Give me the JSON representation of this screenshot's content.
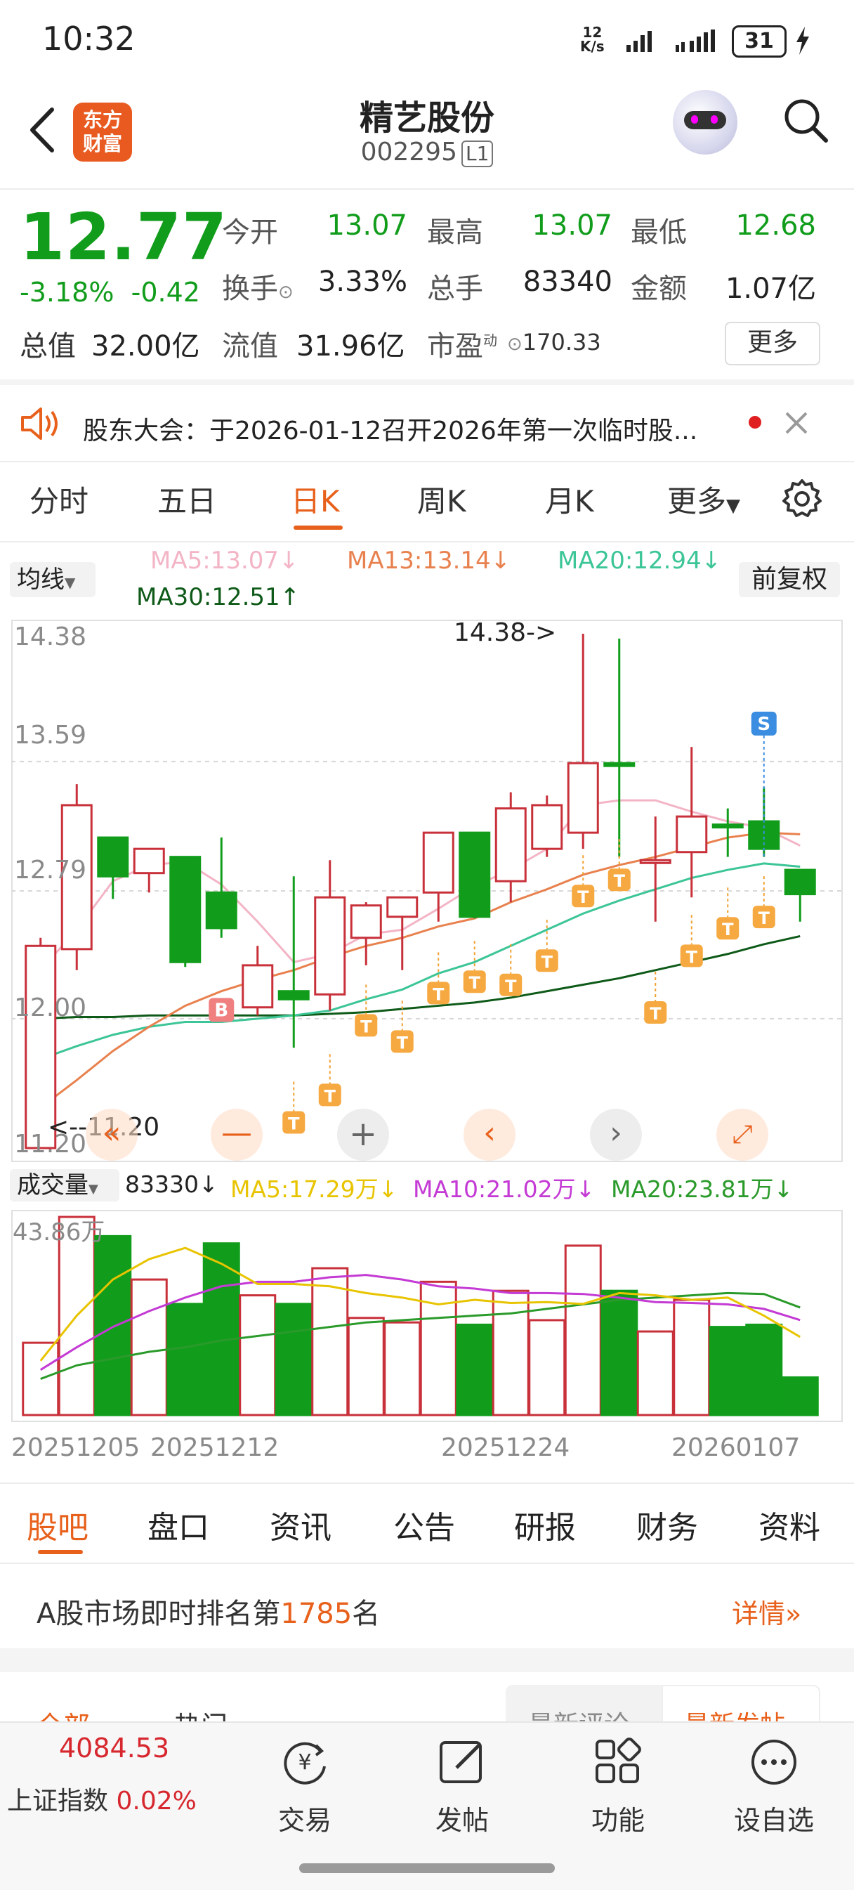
{
  "status": {
    "time": "10:32",
    "net_speed_top": "12",
    "net_speed_unit": "K/s",
    "battery": "31"
  },
  "header": {
    "logo_line1": "东方",
    "logo_line2": "财富",
    "name": "精艺股份",
    "code": "002295",
    "level": "L1"
  },
  "quote": {
    "price": "12.77",
    "change_pct": "-3.18%",
    "change_amt": "-0.42",
    "open_label": "今开",
    "open": "13.07",
    "high_label": "最高",
    "high": "13.07",
    "low_label": "最低",
    "low": "12.68",
    "turnover_label": "换手",
    "turnover": "3.33%",
    "volume_label": "总手",
    "volume": "83340",
    "amount_label": "金额",
    "amount": "1.07亿",
    "mktcap_label": "总值",
    "mktcap": "32.00亿",
    "float_label": "流值",
    "float_cap": "31.96亿",
    "pe_label": "市盈",
    "pe_sup": "动",
    "pe": "170.33",
    "more_label": "更多"
  },
  "notice": {
    "text": "股东大会：于2026-01-12召开2026年第一次临时股..."
  },
  "kline_tabs": [
    "分时",
    "五日",
    "日K",
    "周K",
    "月K",
    "更多"
  ],
  "kline_toolbar": {
    "ma_select": "均线",
    "fq_button": "前复权",
    "ma5": "MA5:13.07↓",
    "ma13": "MA13:13.14↓",
    "ma20": "MA20:12.94↓",
    "ma30": "MA30:12.51↑"
  },
  "kline_labels": {
    "y_top": "14.38",
    "y_2": "13.59",
    "y_3": "12.79",
    "y_4": "12.00",
    "y_bottom": "11.20",
    "max_marker": "14.38->",
    "min_marker": "<--11.20"
  },
  "volume_toolbar": {
    "select": "成交量",
    "value": "83330↓",
    "ma5": "MA5:17.29万↓",
    "ma10": "MA10:21.02万↓",
    "ma20": "MA20:23.81万↓",
    "y_top": "43.86万"
  },
  "x_dates": [
    "20251205",
    "20251212",
    "20251224",
    "20260107"
  ],
  "colors": {
    "up": "#c8303a",
    "down": "#119d1b",
    "accent": "#e8611c",
    "ma5": "#f3b5c6",
    "ma13": "#e8814e",
    "ma20": "#3cc596",
    "ma30": "#0e5a18",
    "vma5": "#e8c400",
    "vma10": "#c43ad4",
    "vma20": "#2a9a2a"
  },
  "chart_data": {
    "type": "candlestick",
    "candles": [
      {
        "o": 11.2,
        "h": 12.5,
        "l": 11.2,
        "c": 12.45,
        "dir": "up"
      },
      {
        "o": 12.43,
        "h": 13.45,
        "l": 12.3,
        "c": 13.32,
        "dir": "up"
      },
      {
        "o": 13.12,
        "h": 13.12,
        "l": 12.74,
        "c": 12.88,
        "dir": "down"
      },
      {
        "o": 12.9,
        "h": 13.05,
        "l": 12.78,
        "c": 13.05,
        "dir": "up"
      },
      {
        "o": 13.0,
        "h": 13.0,
        "l": 12.32,
        "c": 12.35,
        "dir": "down"
      },
      {
        "o": 12.78,
        "h": 13.12,
        "l": 12.5,
        "c": 12.56,
        "dir": "down"
      },
      {
        "o": 12.07,
        "h": 12.45,
        "l": 12.02,
        "c": 12.33,
        "dir": "up"
      },
      {
        "o": 12.17,
        "h": 12.88,
        "l": 11.82,
        "c": 12.12,
        "dir": "down"
      },
      {
        "o": 12.15,
        "h": 12.98,
        "l": 12.05,
        "c": 12.75,
        "dir": "up"
      },
      {
        "o": 12.5,
        "h": 12.72,
        "l": 12.33,
        "c": 12.7,
        "dir": "up"
      },
      {
        "o": 12.63,
        "h": 12.75,
        "l": 12.3,
        "c": 12.75,
        "dir": "up"
      },
      {
        "o": 12.78,
        "h": 13.15,
        "l": 12.6,
        "c": 13.15,
        "dir": "up"
      },
      {
        "o": 13.15,
        "h": 13.15,
        "l": 12.62,
        "c": 12.63,
        "dir": "down"
      },
      {
        "o": 12.85,
        "h": 13.4,
        "l": 12.72,
        "c": 13.3,
        "dir": "up"
      },
      {
        "o": 13.05,
        "h": 13.38,
        "l": 13.0,
        "c": 13.32,
        "dir": "up"
      },
      {
        "o": 13.15,
        "h": 14.38,
        "l": 13.05,
        "c": 13.58,
        "dir": "up"
      },
      {
        "o": 13.58,
        "h": 14.35,
        "l": 13.0,
        "c": 13.58,
        "dir": "down"
      },
      {
        "o": 12.98,
        "h": 13.25,
        "l": 12.6,
        "c": 12.98,
        "dir": "up"
      },
      {
        "o": 13.03,
        "h": 13.68,
        "l": 12.75,
        "c": 13.25,
        "dir": "up"
      },
      {
        "o": 13.2,
        "h": 13.3,
        "l": 13.0,
        "c": 13.2,
        "dir": "down"
      },
      {
        "o": 13.22,
        "h": 13.43,
        "l": 13.0,
        "c": 13.05,
        "dir": "down"
      },
      {
        "o": 12.92,
        "h": 12.92,
        "l": 12.6,
        "c": 12.77,
        "dir": "down"
      }
    ],
    "ma5": [
      12.3,
      12.55,
      12.85,
      12.95,
      12.97,
      12.83,
      12.6,
      12.35,
      12.4,
      12.52,
      12.55,
      12.68,
      12.82,
      12.92,
      13.05,
      13.32,
      13.35,
      13.35,
      13.28,
      13.22,
      13.18,
      13.07
    ],
    "ma13": [
      11.45,
      11.62,
      11.8,
      11.95,
      12.08,
      12.17,
      12.24,
      12.3,
      12.38,
      12.45,
      12.5,
      12.57,
      12.62,
      12.72,
      12.8,
      12.89,
      12.95,
      13.0,
      13.06,
      13.12,
      13.15,
      13.14
    ],
    "ma20": [
      11.75,
      11.83,
      11.9,
      11.95,
      11.98,
      11.98,
      12.0,
      12.02,
      12.05,
      12.12,
      12.18,
      12.28,
      12.35,
      12.45,
      12.55,
      12.65,
      12.73,
      12.8,
      12.87,
      12.92,
      12.96,
      12.94
    ],
    "ma30": [
      12.0,
      12.01,
      12.01,
      12.02,
      12.02,
      12.02,
      12.02,
      12.02,
      12.03,
      12.04,
      12.06,
      12.08,
      12.1,
      12.13,
      12.17,
      12.21,
      12.25,
      12.3,
      12.35,
      12.4,
      12.46,
      12.51
    ],
    "ylim": [
      11.2,
      14.38
    ],
    "volume": [
      16.0,
      43.86,
      39.6,
      30.0,
      24.6,
      38.0,
      26.5,
      24.6,
      32.5,
      21.5,
      20.5,
      29.5,
      20.0,
      27.5,
      21.0,
      37.5,
      27.5,
      18.5,
      25.5,
      19.5,
      20.0,
      8.33
    ],
    "vma5": [
      12.0,
      22.0,
      30.0,
      34.5,
      37.0,
      33.5,
      29.0,
      29.0,
      28.5,
      27.0,
      26.0,
      24.5,
      25.5,
      24.8,
      25.0,
      24.6,
      27.0,
      26.5,
      25.5,
      26.0,
      22.0,
      17.29
    ],
    "vma10": [
      10.0,
      15.0,
      19.5,
      23.0,
      26.0,
      28.5,
      29.5,
      29.5,
      30.5,
      31.0,
      30.0,
      28.5,
      28.0,
      27.0,
      27.0,
      26.8,
      26.0,
      25.0,
      24.8,
      24.5,
      23.5,
      21.02
    ],
    "vma20": [
      8.0,
      11.0,
      12.5,
      14.0,
      15.0,
      16.5,
      17.5,
      18.5,
      19.5,
      20.5,
      21.0,
      21.5,
      22.0,
      22.5,
      23.5,
      24.5,
      25.5,
      26.0,
      26.5,
      27.0,
      26.8,
      23.81
    ],
    "vylim": [
      0,
      43.86
    ]
  },
  "bottom_tabs": [
    "股吧",
    "盘口",
    "资讯",
    "公告",
    "研报",
    "财务",
    "资料"
  ],
  "rank": {
    "prefix": "A股市场即时排名第",
    "number": "1785",
    "suffix": "名",
    "detail": "详情"
  },
  "sub_tabs": {
    "all": "全部",
    "hot": "热门",
    "latest_comment": "最新评论",
    "latest_post": "最新发帖"
  },
  "index_bar": {
    "value": "4084.53",
    "name": "上证指数",
    "pct": "0.02%"
  },
  "nav": [
    "交易",
    "发帖",
    "功能",
    "设自选"
  ]
}
